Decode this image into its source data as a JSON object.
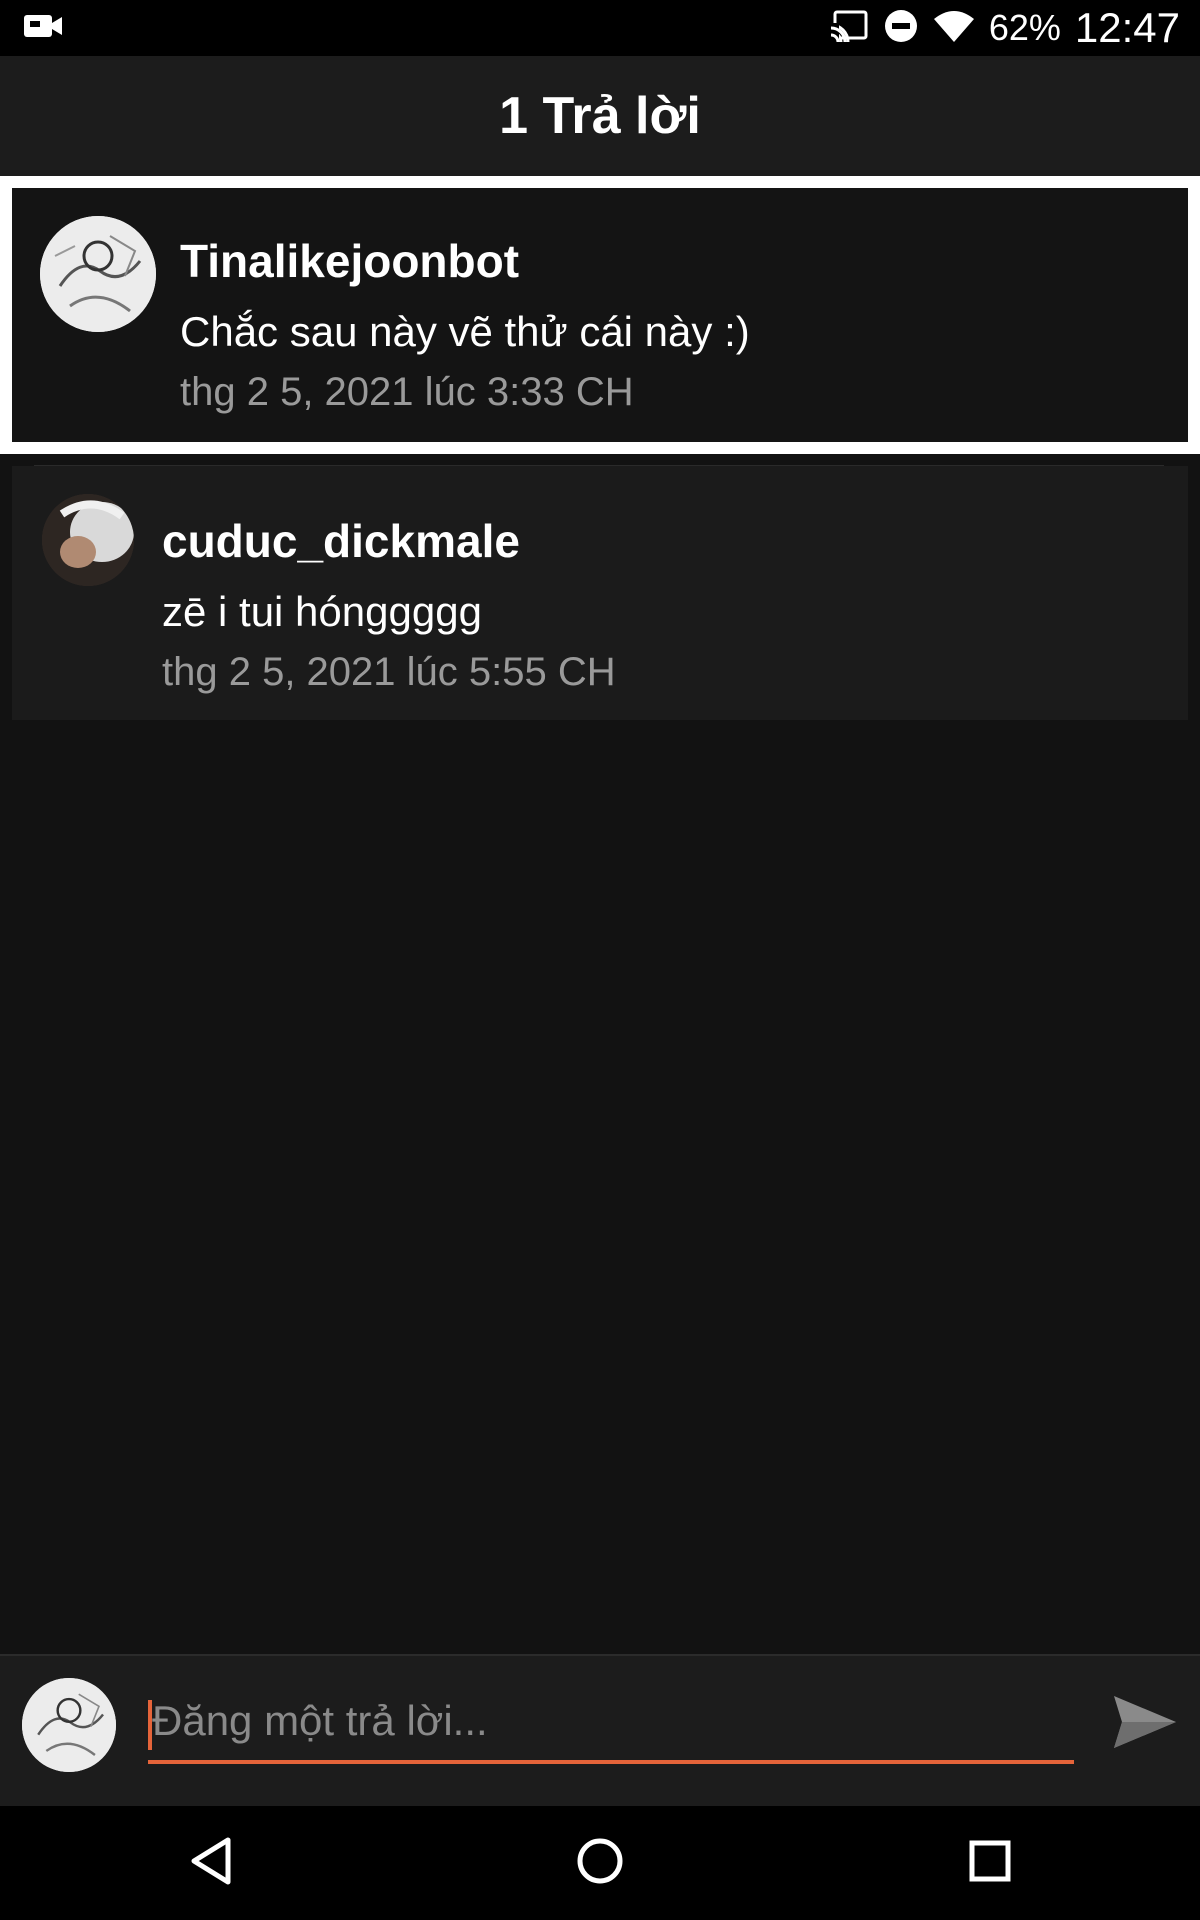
{
  "status_bar": {
    "battery": "62%",
    "time": "12:47",
    "icons": [
      "video-call-icon",
      "cast-icon",
      "do-not-disturb-icon",
      "wifi-icon"
    ]
  },
  "app_bar": {
    "title": "1 Trả lời"
  },
  "comments": [
    {
      "author": "Tinalikejoonbot",
      "text": "Chắc sau này vẽ thử cái này :)",
      "time": "thg 2 5, 2021 lúc 3:33 CH",
      "highlighted": true
    },
    {
      "author": "cuduc_dickmale",
      "text": "zē i tui hónggggg",
      "time": "thg 2 5, 2021 lúc 5:55 CH",
      "highlighted": false
    }
  ],
  "reply_input": {
    "placeholder": "Đăng một trả lời..."
  },
  "colors": {
    "accent": "#e5643a",
    "background": "#121212",
    "app_bar": "#1c1c1c",
    "secondary_text": "#9a9a9a"
  },
  "nav_bar": {
    "icons": [
      "back-icon",
      "home-icon",
      "recents-icon"
    ]
  }
}
